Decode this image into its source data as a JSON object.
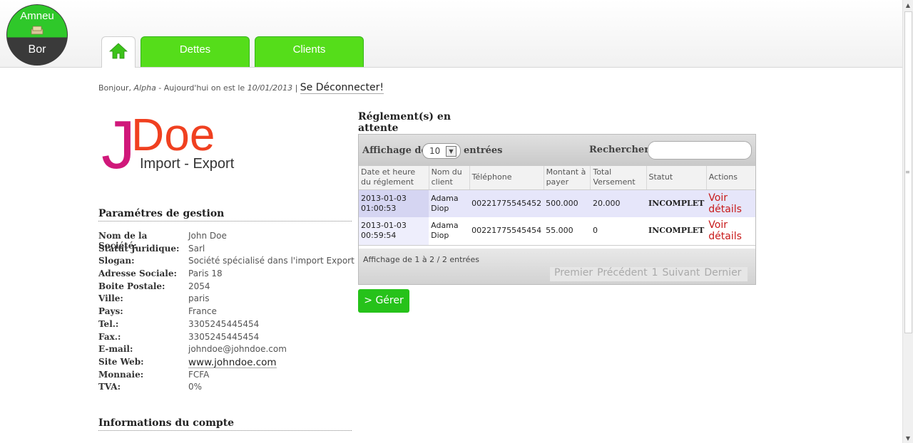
{
  "header": {
    "logo_top": "Amneu",
    "logo_bottom": "Bor",
    "tabs": [
      {
        "label": ""
      },
      {
        "label": "Dettes"
      },
      {
        "label": "Clients"
      }
    ]
  },
  "greeting": {
    "prefix": "Bonjour, ",
    "user": "Alpha",
    "middle": " - Aujourd'hui on est le ",
    "date": "10/01/2013",
    "separator": " | ",
    "logout": "Se Déconnecter!"
  },
  "company_logo": {
    "letter": "J",
    "name": "Doe",
    "tagline": "Import - Export"
  },
  "params": {
    "title": "Paramétres de gestion",
    "rows": [
      {
        "k": "Nom de la Société:",
        "v": "John Doe"
      },
      {
        "k": "Statut Juridique:",
        "v": "Sarl"
      },
      {
        "k": "Slogan:",
        "v": "Société spécialisé dans l'import Export"
      },
      {
        "k": "Adresse Sociale:",
        "v": "Paris 18"
      },
      {
        "k": "Boite Postale:",
        "v": "2054"
      },
      {
        "k": "Ville:",
        "v": "paris"
      },
      {
        "k": "Pays:",
        "v": "France"
      },
      {
        "k": "Tel.:",
        "v": "3305245445454"
      },
      {
        "k": "Fax.:",
        "v": "3305245445454"
      },
      {
        "k": "E-mail:",
        "v": "johndoe@johndoe.com"
      },
      {
        "k": "Site Web:",
        "v": "www.johndoe.com"
      },
      {
        "k": "Monnaie:",
        "v": "FCFA"
      },
      {
        "k": "TVA:",
        "v": "0%"
      }
    ]
  },
  "account": {
    "title": "Informations du compte"
  },
  "reglements": {
    "title": "Réglement(s) en attente",
    "length_label": "Affichage de",
    "length_value": "10",
    "entries_label": "entrées",
    "search_label": "Rechercher:",
    "search_value": "",
    "columns": [
      "Date et heure du réglement",
      "Nom du client",
      "Téléphone",
      "Montant à payer",
      "Total Versement",
      "Statut",
      "Actions"
    ],
    "rows": [
      {
        "date": "2013-01-03 01:00:53",
        "client": "Adama Diop",
        "tel": "00221775545452",
        "montant": "500.000",
        "versement": "20.000",
        "statut": "INCOMPLET",
        "action": "Voir détails"
      },
      {
        "date": "2013-01-03 00:59:54",
        "client": "Adama Diop",
        "tel": "00221775545454",
        "montant": "55.000",
        "versement": "0",
        "statut": "INCOMPLET",
        "action": "Voir détails"
      }
    ],
    "info": "Affichage de 1 à 2 / 2 entrées",
    "pager": {
      "first": "Premier",
      "prev": "Précédent",
      "page": "1",
      "next": "Suivant",
      "last": "Dernier"
    }
  },
  "actions": {
    "manage_label": "> Gérer"
  }
}
